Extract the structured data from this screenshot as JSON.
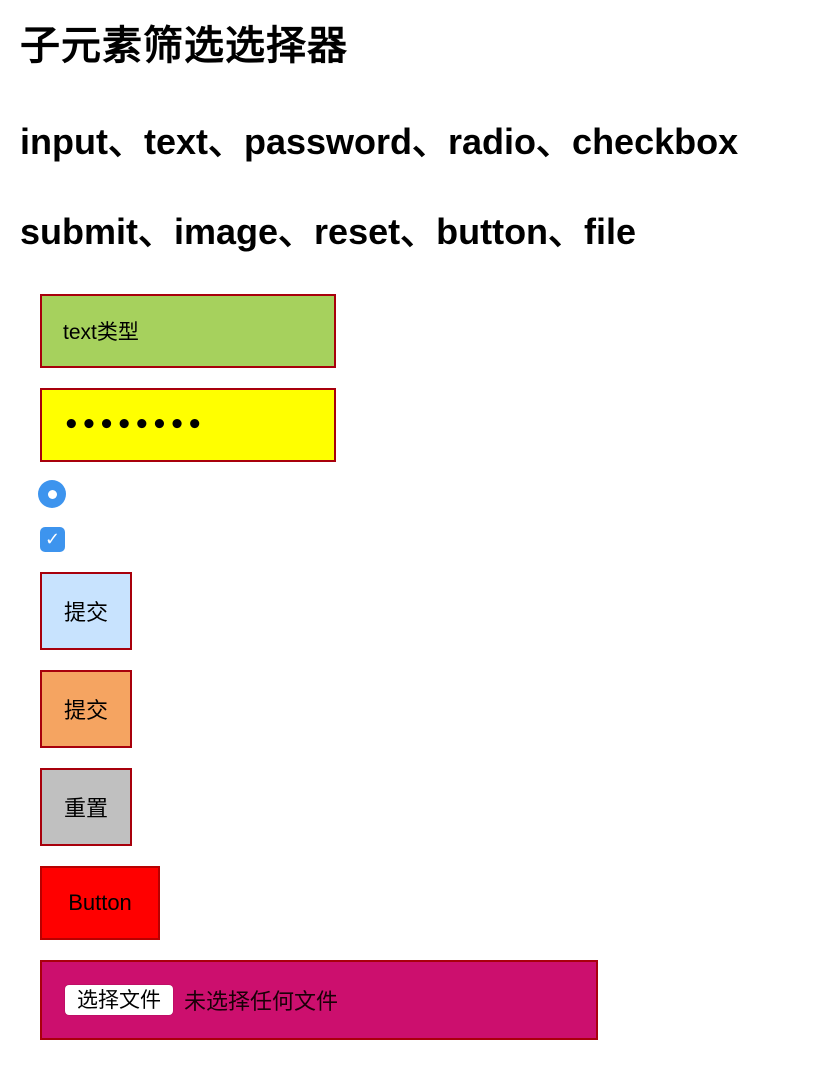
{
  "page": {
    "title": "子元素筛选选择器",
    "subtitle_line1": "input、text、password、radio、checkbox",
    "subtitle_line2": "submit、image、reset、button、file"
  },
  "form": {
    "text_input": {
      "value": "text类型",
      "background": "#a6d15d"
    },
    "password_input": {
      "masked_value": "••••••••",
      "background": "#ffff00"
    },
    "radio": {
      "checked": true,
      "color": "#3d94ee"
    },
    "checkbox": {
      "checked": true,
      "check_glyph": "✓",
      "color": "#3d94ee"
    },
    "submit_button": {
      "label": "提交",
      "background": "#c8e3fe"
    },
    "image_button": {
      "label": "提交",
      "background": "#f5a461"
    },
    "reset_button": {
      "label": "重置",
      "background": "#c0c0c0"
    },
    "plain_button": {
      "label": "Button",
      "background": "#ff0000"
    },
    "file_input": {
      "button_label": "选择文件",
      "status": "未选择任何文件",
      "background": "#cc0f6e"
    },
    "border_color": "#a8000c"
  }
}
